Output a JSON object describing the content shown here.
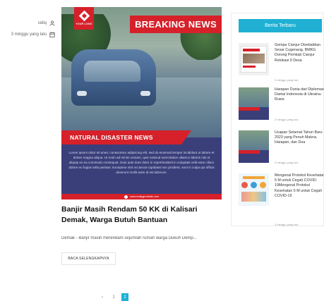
{
  "meta": {
    "author": "sidiq",
    "date": "3 minggu yang lalu",
    "author_icon": "user-icon",
    "date_icon": "calendar-icon"
  },
  "poster": {
    "logo_text": "YOUR LOGO",
    "breaking_label": "BREAKING NEWS",
    "band_label": "NATURAL DISASTER NEWS",
    "body_text": "Lorem ipsum dolor sit amet, consectetur adipiscing elit, sed do eiusmod tempor incididunt ut labore et dolore magna aliqua. Ut enim ad minim veniam, quis nostrud exercitation ullamco laboris nisi ut aliquip ex ea commodo consequat. Duis aute irure dolor in reprehenderit in voluptate velit esse cillum dolore eu fugiat nulla pariatur. Excepteur sint occaecat cupidatat non proident, sunt in culpa qui officia deserunt mollit anim id est laborum.",
    "url": "www.reallygreatsite.com",
    "accent": "#d6202a",
    "background": "#3a3f7a"
  },
  "post": {
    "title": "Banjir Masih Rendam 50 KK di Kalisari Demak, Warga Butuh Bantuan",
    "excerpt": "Demak - Banjir masih merendam sejumlah rumah warga Dukuh Demp...",
    "read_more": "BACA SELENGKAPNYA"
  },
  "pagination": {
    "prev": "‹",
    "pages": [
      "1",
      "2"
    ],
    "current": "2",
    "accent": "#1fb0d4"
  },
  "sidebar": {
    "title": "Berita Terbaru",
    "items": [
      {
        "title": "Gempa Cianjur Disebabkan Sesar Cugenang, BMKG Dorong Pemkab Cianjur Relokasi 9 Desa",
        "date": "3 minggu yang lalu"
      },
      {
        "title": "Harapan Dunia dari Diplomasi Damai Indonesia di Ukraina-Rusia",
        "date": "3 minggu yang lalu"
      },
      {
        "title": "Ucapan Selamat Tahun Baru 2023 yang Penuh Makna, Harapan, dan Doa",
        "date": "3 minggu yang lalu"
      },
      {
        "title": "Mengenal Protokol Kesehatan 5 M untuk Cegah COVID-19Mengenal Protokol Kesehatan 5 M untuk Cegah COVID-19",
        "date": "3 minggu yang lalu"
      }
    ]
  }
}
